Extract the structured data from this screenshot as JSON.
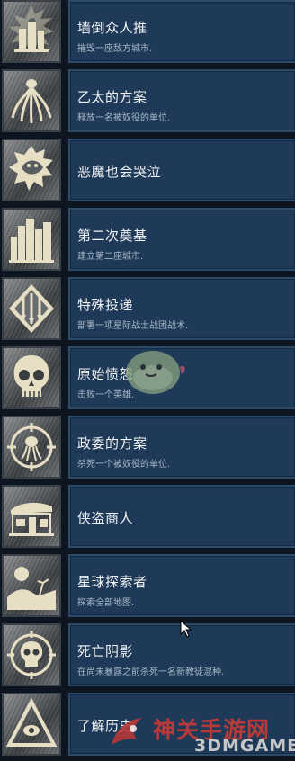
{
  "achievements": [
    {
      "icon": "collapsed-city-icon",
      "title": "墙倒众人推",
      "desc": "摧毁一座敌方城市."
    },
    {
      "icon": "tentacle-creature-icon",
      "title": "乙太的方案",
      "desc": "释放一名被奴役的单位."
    },
    {
      "icon": "demon-scream-icon",
      "title": "恶魔也会哭泣",
      "desc": ""
    },
    {
      "icon": "city-skyline-icon",
      "title": "第二次奠基",
      "desc": "建立第二座城市."
    },
    {
      "icon": "orbital-drop-icon",
      "title": "特殊投递",
      "desc": "部署一项星际战士战团战术."
    },
    {
      "icon": "skull-icon",
      "title": "原始愤怒",
      "desc": "击败一个英雄."
    },
    {
      "icon": "crosshair-creature-icon",
      "title": "政委的方案",
      "desc": "杀死一个被奴役的单位."
    },
    {
      "icon": "market-stall-icon",
      "title": "侠盗商人",
      "desc": ""
    },
    {
      "icon": "planet-landscape-icon",
      "title": "星球探索者",
      "desc": "探索全部地图."
    },
    {
      "icon": "skull-target-icon",
      "title": "死亡阴影",
      "desc": "在尚未暴露之前杀死一名新教徒混种."
    },
    {
      "icon": "eye-triangle-icon",
      "title": "了解历史",
      "desc": ""
    }
  ],
  "watermark": {
    "cn": "神关手游网",
    "en": "3DMGAME"
  }
}
